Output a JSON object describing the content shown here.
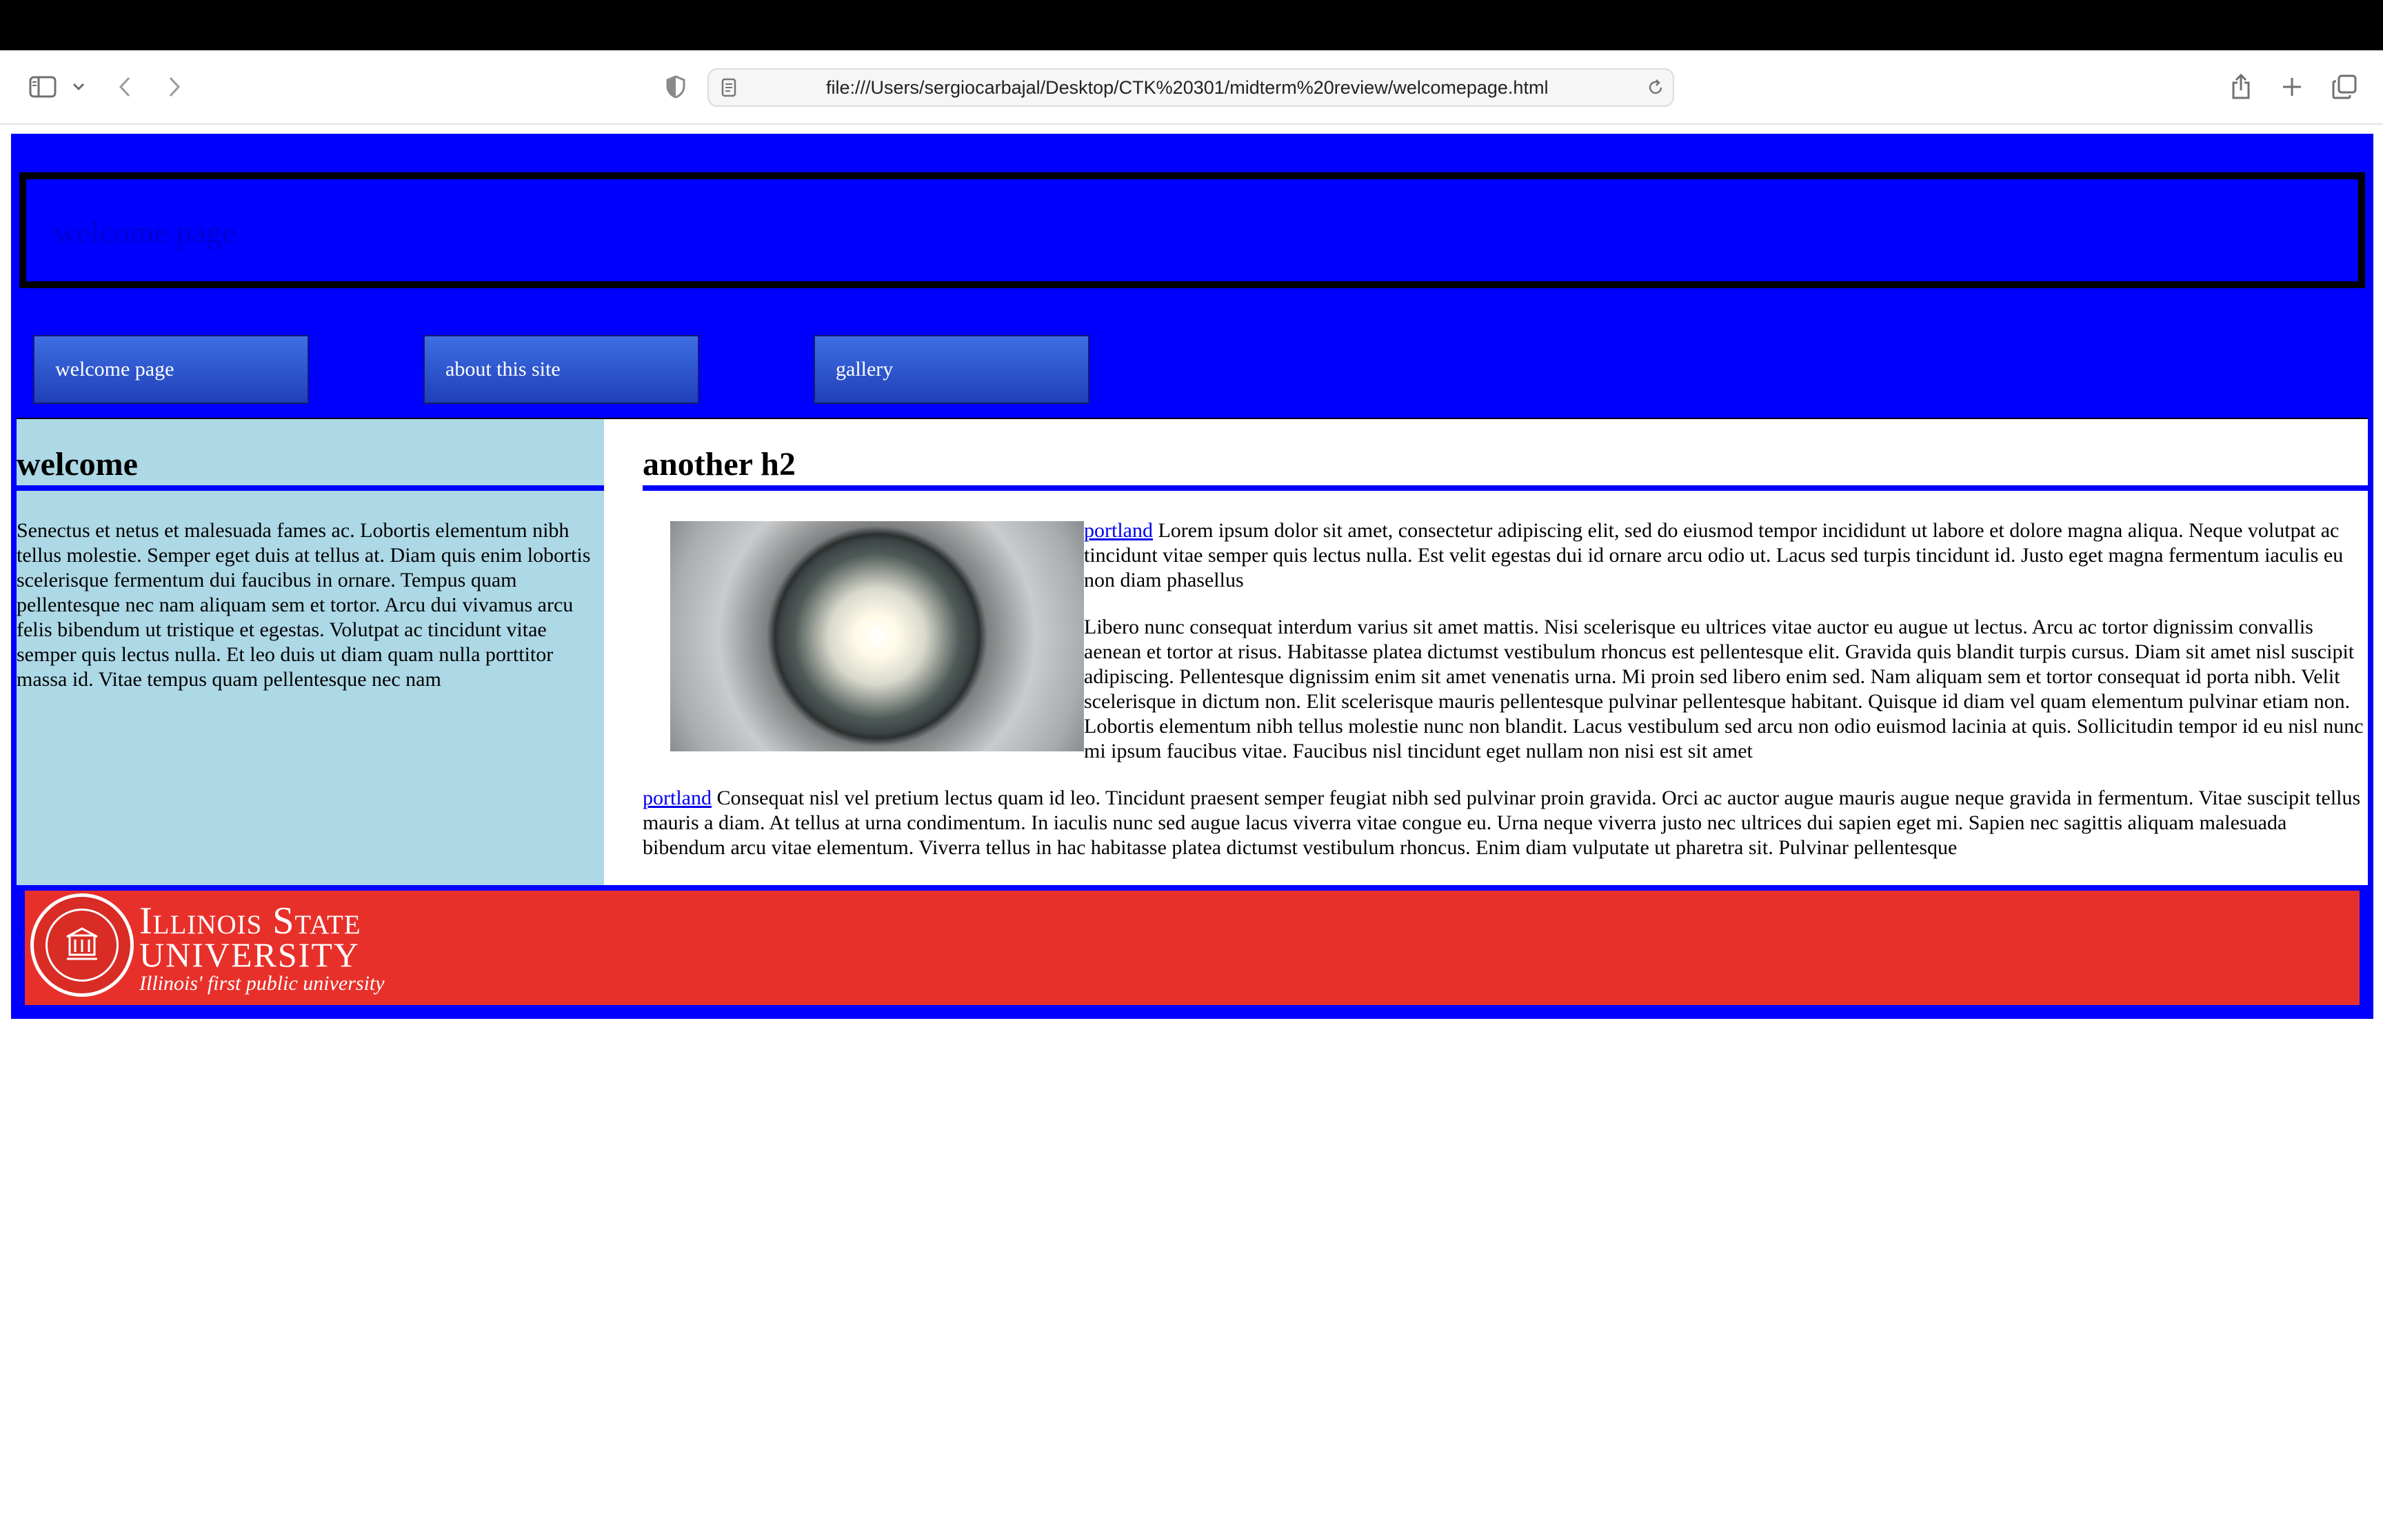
{
  "browser": {
    "url": "file:///Users/sergiocarbajal/Desktop/CTK%20301/midterm%20review/welcomepage.html"
  },
  "page": {
    "header_title": "welcome page",
    "nav": [
      "welcome page",
      "about this site",
      "gallery"
    ],
    "left": {
      "heading": "welcome",
      "text": "Senectus et netus et malesuada fames ac. Lobortis elementum nibh tellus molestie. Semper eget duis at tellus at. Diam quis enim lobortis scelerisque fermentum dui faucibus in ornare. Tempus quam pellentesque nec nam aliquam sem et tortor. Arcu dui vivamus arcu felis bibendum ut tristique et egestas. Volutpat ac tincidunt vitae semper quis lectus nulla. Et leo duis ut diam quam nulla porttitor massa id. Vitae tempus quam pellentesque nec nam"
    },
    "main": {
      "heading": "another h2",
      "para1_link": "portland",
      "para1_text": " Lorem ipsum dolor sit amet, consectetur adipiscing elit, sed do eiusmod tempor incididunt ut labore et dolore magna aliqua. Neque volutpat ac tincidunt vitae semper quis lectus nulla. Est velit egestas dui id ornare arcu odio ut. Lacus sed turpis tincidunt id. Justo eget magna fermentum iaculis eu non diam phasellus",
      "para2_text": "Libero nunc consequat interdum varius sit amet mattis. Nisi scelerisque eu ultrices vitae auctor eu augue ut lectus. Arcu ac tortor dignissim convallis aenean et tortor at risus. Habitasse platea dictumst vestibulum rhoncus est pellentesque elit. Gravida quis blandit turpis cursus. Diam sit amet nisl suscipit adipiscing. Pellentesque dignissim enim sit amet venenatis urna. Mi proin sed libero enim sed. Nam aliquam sem et tortor consequat id porta nibh. Velit scelerisque in dictum non. Elit scelerisque mauris pellentesque pulvinar pellentesque habitant. Quisque id diam vel quam elementum pulvinar etiam non. Lobortis elementum nibh tellus molestie nunc non blandit. Lacus vestibulum sed arcu non odio euismod lacinia at quis. Sollicitudin tempor id eu nisl nunc mi ipsum faucibus vitae. Faucibus nisl tincidunt eget nullam non nisi est sit amet",
      "para3_link": "portland",
      "para3_text": " Consequat nisl vel pretium lectus quam id leo. Tincidunt praesent semper feugiat nibh sed pulvinar proin gravida. Orci ac auctor augue mauris augue neque gravida in fermentum. Vitae suscipit tellus mauris a diam. At tellus at urna condimentum. In iaculis nunc sed augue lacus viverra vitae congue eu. Urna neque viverra justo nec ultrices dui sapien eget mi. Sapien nec sagittis aliquam malesuada bibendum arcu vitae elementum. Viverra tellus in hac habitasse platea dictumst vestibulum rhoncus. Enim diam vulputate ut pharetra sit. Pulvinar pellentesque"
    },
    "footer": {
      "logo_line1": "Illinois State",
      "logo_line2": "UNIVERSITY",
      "logo_tagline": "Illinois' first public university"
    }
  },
  "colors": {
    "page_border": "#0000ff",
    "left_column": "#add8e6",
    "footer": "#e8302a",
    "nav_button": "#2f55d0"
  }
}
